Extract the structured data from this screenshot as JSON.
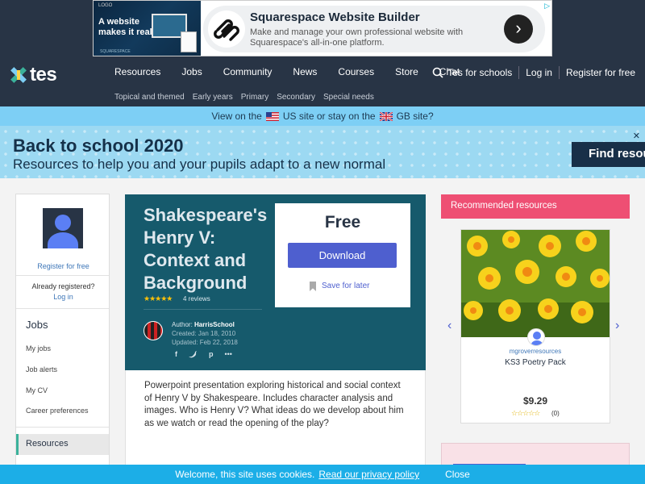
{
  "ad": {
    "image_headline": "A website makes it real.",
    "image_logo": "LOGO",
    "image_brand": "SQUARESPACE",
    "title": "Squarespace Website Builder",
    "description": "Make and manage your own professional website with Squarespace's all-in-one platform.",
    "arrow": "›",
    "choices_icon": "▷"
  },
  "nav": {
    "logo": "tes",
    "items": [
      "Resources",
      "Jobs",
      "Community",
      "News",
      "Courses",
      "Store",
      "Chat"
    ],
    "search_label": "Tes for schools",
    "login": "Log in",
    "register": "Register for free",
    "subitems": [
      "Topical and themed",
      "Early years",
      "Primary",
      "Secondary",
      "Special needs"
    ]
  },
  "site_bar": {
    "view_on_the": "View on the",
    "us_site": "US site or stay on the",
    "gb_site": "GB site?"
  },
  "banner": {
    "title": "Back to school 2020",
    "subtitle": "Resources to help you and your pupils adapt to a new normal",
    "button": "Find resou",
    "close": "✕"
  },
  "sidebar": {
    "register": "Register for free",
    "already": "Already registered?",
    "login": "Log in",
    "jobs_heading": "Jobs",
    "links": [
      "My jobs",
      "Job alerts",
      "My CV",
      "Career preferences"
    ],
    "active": "Resources"
  },
  "resource": {
    "title": "Shakespeare's Henry V: Context and Background",
    "stars": "★★★★★",
    "reviews": "4 reviews",
    "author_label": "Author:",
    "author": "HarrisSchool",
    "created": "Created: Jan 18, 2010",
    "updated": "Updated: Feb 22, 2018",
    "price": "Free",
    "download": "Download",
    "save": "Save for later",
    "description": "Powerpoint presentation exploring historical and social context of Henry V by Shakespeare. Includes character analysis and images. Who is Henry V? What ideas do we develop about him as we watch or read the opening of the play?"
  },
  "recommended": {
    "heading": "Recommended resources",
    "author": "mgroverresources",
    "name": "KS3 Poetry Pack",
    "price": "$9.29",
    "stars": "☆☆☆☆☆",
    "count": "(0)",
    "prev": "‹",
    "next": "›"
  },
  "cookie": {
    "text": "Welcome, this site uses cookies.",
    "link": "Read our privacy policy",
    "close": "Close"
  },
  "colors": {
    "navy": "#283445",
    "teal": "#165a6c",
    "pink": "#ee4f73",
    "button_blue": "#4e5fcf",
    "cookie_blue": "#1caee7"
  }
}
